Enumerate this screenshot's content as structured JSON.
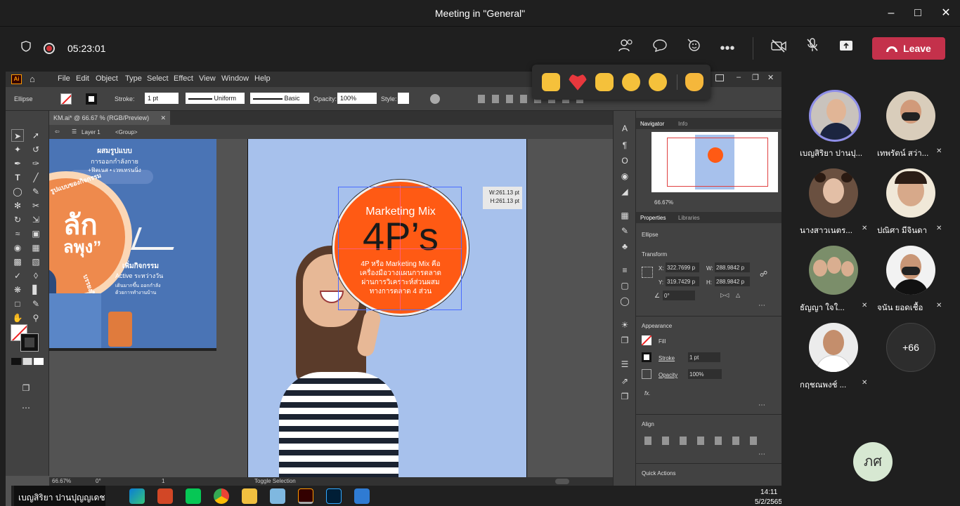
{
  "window": {
    "title": "Meeting in \"General\""
  },
  "meeting": {
    "timer": "05:23:01",
    "leave_label": "Leave"
  },
  "illustrator": {
    "menu": [
      "File",
      "Edit",
      "Object",
      "Type",
      "Select",
      "Effect",
      "View",
      "Window",
      "Help"
    ],
    "control": {
      "selection": "Ellipse",
      "stroke_label": "Stroke:",
      "stroke_value": "1 pt",
      "uniform": "Uniform",
      "basic": "Basic",
      "opacity_label": "Opacity:",
      "opacity_value": "100%",
      "style_label": "Style:"
    },
    "doc_tab": "KM.ai* @ 66.67 % (RGB/Preview)",
    "breadcrumb": {
      "layer": "Layer 1",
      "group": "<Group>"
    },
    "size_tooltip": {
      "w": "W:261.13 pt",
      "h": "H:261.13 pt"
    },
    "artwork": {
      "title": "Marketing Mix",
      "big": "4P’s",
      "line1": "4P หรือ Marketing Mix คือ",
      "line2": "เครื่องมือวางแผนการตลาด",
      "line3": "ผ่านการวิเคราะห์ส่วนผสม",
      "line4": "ทางการตลาด 4 ส่วน",
      "left1": "ผสมรูปแบบ",
      "left2": "การออกกำลังกาย",
      "left3": "+ฟิตเนส • เวทเทรนนิ่ง",
      "left4": "เพิ่มกิจกรรม",
      "left5": "Active ระหว่างวัน",
      "left6": "เดินมากขึ้น ออกกำลัง",
      "left7": "ด้วยการทำงานบ้าน",
      "left8": "รูปแบบของกิจกรรม",
      "left9": "ลัก",
      "left10": "ลพุง”",
      "left11": "บรรยงกิจกร"
    },
    "navigator": {
      "tab1": "Navigator",
      "tab2": "Info",
      "zoom": "66.67%"
    },
    "properties": {
      "tab1": "Properties",
      "tab2": "Libraries",
      "object": "Ellipse",
      "transform": "Transform",
      "x_label": "X:",
      "x": "322.7699 p",
      "y_label": "Y:",
      "y": "319.7429 p",
      "w_label": "W:",
      "w": "288.9842 p",
      "h_label": "H:",
      "h": "288.9842 p",
      "angle": "0°",
      "appearance": "Appearance",
      "fill": "Fill",
      "stroke": "Stroke",
      "stroke_val": "1 pt",
      "opacity": "Opacity",
      "opacity_val": "100%",
      "fx": "fx.",
      "align": "Align",
      "quick": "Quick Actions"
    },
    "status": {
      "zoom": "66.67%",
      "angle": "0°",
      "page": "1",
      "mode": "Toggle Selection"
    }
  },
  "taskbar": {
    "presenter": "เบญสิริยา ปานปุญญเดช",
    "time": "14:11",
    "date": "5/2/2565"
  },
  "participants": [
    {
      "name": "เบญสิริยา ปานปุ...",
      "muted": false
    },
    {
      "name": "เทพรัตน์ สว่า...",
      "muted": true
    },
    {
      "name": "นางสาวเนตร...",
      "muted": true
    },
    {
      "name": "ปณิศา มีจินดา",
      "muted": true
    },
    {
      "name": "ธัญญา ใจใ...",
      "muted": true
    },
    {
      "name": "จนัน ยอดเชื้อ",
      "muted": true
    },
    {
      "name": "กฤชณพงช์ ...",
      "muted": true
    }
  ],
  "more_count": "+66",
  "self_initials": "ภศ"
}
